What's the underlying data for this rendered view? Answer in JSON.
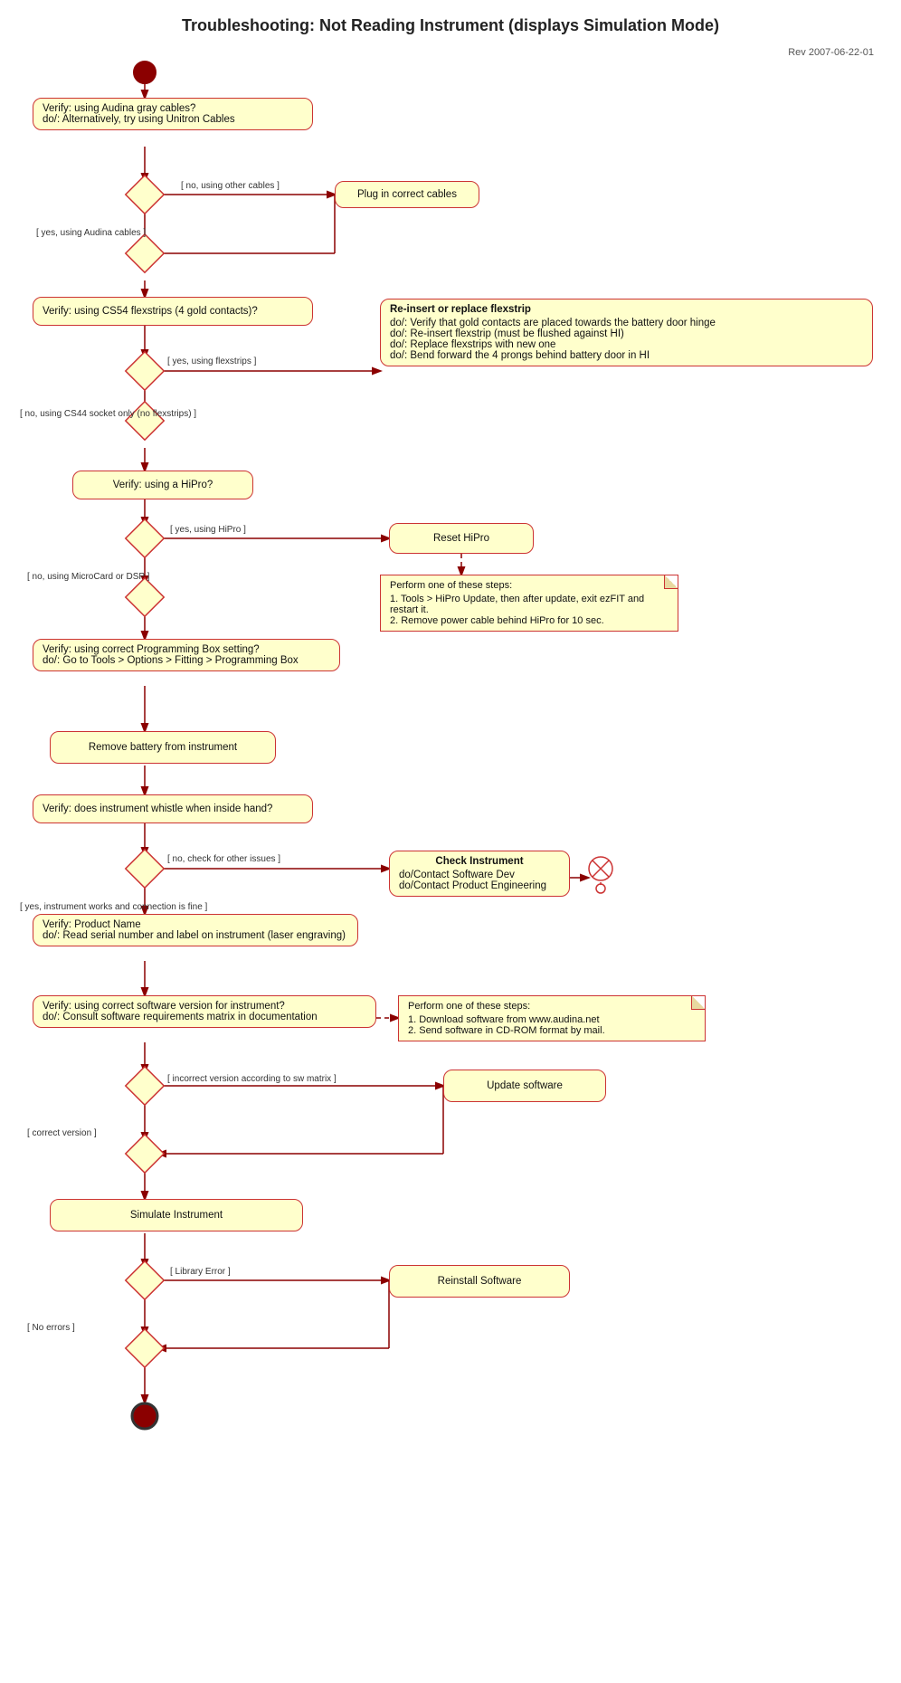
{
  "title": "Troubleshooting: Not Reading Instrument (displays Simulation Mode)",
  "rev": "Rev 2007-06-22-01",
  "nodes": {
    "start": {
      "label": "start"
    },
    "verify_cables": {
      "label": "Verify: using Audina gray cables?\ndo/: Alternatively, try using Unitron Cables"
    },
    "plug_cables": {
      "label": "Plug in correct cables"
    },
    "verify_flexstrips": {
      "label": "Verify: using CS54 flexstrips (4 gold contacts)?"
    },
    "reinsert_flexstrip": {
      "label": "Re-insert or replace flexstrip\ndo/: Verify that gold contacts are placed towards the battery door hinge\ndo/: Re-insert flexstrip (must be flushed against HI)\ndo/: Replace flexstrips with new one\ndo/: Bend forward the 4 prongs behind battery door in HI"
    },
    "verify_hipro": {
      "label": "Verify: using a HiPro?"
    },
    "reset_hipro": {
      "label": "Reset HiPro"
    },
    "hipro_steps": {
      "label": "Perform one of these steps:\n1. Tools > HiPro Update, then after update, exit ezFIT and restart it.\n2. Remove power cable behind HiPro for 10 sec."
    },
    "verify_progbox": {
      "label": "Verify: using correct Programming Box setting?\ndo/: Go to Tools > Options > Fitting > Programming Box"
    },
    "remove_battery": {
      "label": "Remove battery from instrument"
    },
    "verify_whistle": {
      "label": "Verify: does instrument whistle when inside hand?"
    },
    "check_instrument": {
      "label": "Check Instrument\ndo/Contact Software Dev\ndo/Contact Product Engineering"
    },
    "verify_product": {
      "label": "Verify: Product Name\ndo/: Read serial number and label on instrument (laser engraving)"
    },
    "verify_sw_version": {
      "label": "Verify: using correct software version for instrument?\ndo/: Consult software requirements matrix in documentation"
    },
    "sw_steps": {
      "label": "Perform one of these steps:\n1. Download software from www.audina.net\n2. Send software in CD-ROM format by mail."
    },
    "update_software": {
      "label": "Update software"
    },
    "simulate_instrument": {
      "label": "Simulate Instrument"
    },
    "reinstall_software": {
      "label": "Reinstall Software"
    },
    "end": {
      "label": "end"
    }
  },
  "edge_labels": {
    "no_cables": "[ no, using other cables ]",
    "yes_cables": "[ yes, using Audina cables ]",
    "yes_flexstrips": "[ yes, using flexstrips ]",
    "no_flexstrips": "[ no, using CS44 socket only  (no flexstrips) ]",
    "yes_hipro": "[ yes, using HiPro ]",
    "no_hipro": "[ no, using MicroCard or DSP ]",
    "no_whistle": "[ no, check for other issues ]",
    "yes_whistle": "[ yes, instrument works and connection is fine ]",
    "incorrect_version": "[ incorrect version according to sw matrix ]",
    "correct_version": "[ correct version ]",
    "library_error": "[ Library Error ]",
    "no_errors": "[ No errors ]"
  },
  "colors": {
    "box_bg": "#ffffcc",
    "box_border": "#cc3333",
    "arrow": "#8B0000",
    "diamond_fill": "#ffffcc",
    "diamond_stroke": "#cc3333"
  }
}
